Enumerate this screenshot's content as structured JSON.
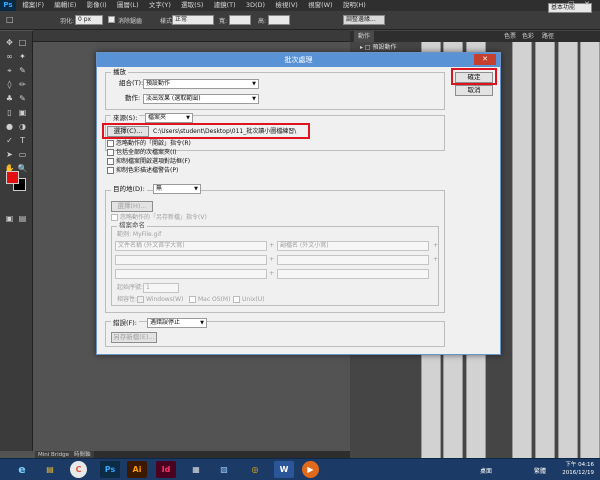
{
  "menubar": {
    "logo": "Ps",
    "items": [
      "檔案(F)",
      "編輯(E)",
      "影像(I)",
      "圖層(L)",
      "文字(Y)",
      "選取(S)",
      "濾鏡(T)",
      "3D(D)",
      "檢視(V)",
      "視窗(W)",
      "說明(H)"
    ]
  },
  "options": {
    "feather_label": "羽化:",
    "feather_value": "0 px",
    "antialias_label": "消除鋸齒",
    "style_label": "樣式:",
    "style_value": "正常",
    "width_label": "寬:",
    "height_label": "高:",
    "refine_button": "調整邊緣...",
    "workspace_value": "基本功能"
  },
  "panel": {
    "tabs": [
      "動作",
      "色票",
      "色彩",
      "路徑"
    ],
    "default_action": "預設動作"
  },
  "bottom_tabs": [
    "Mini Bridge",
    "時間軸"
  ],
  "dialog": {
    "title": "批次處理",
    "ok_button": "確定",
    "reset_button": "取消",
    "play": {
      "legend": "播放",
      "set_label": "組合(T):",
      "set_value": "預設動作",
      "action_label": "動作:",
      "action_value": "淡出效果 (選取範圍)"
    },
    "source": {
      "label": "來源(S):",
      "value": "檔案夾",
      "choose_button": "選擇(C)...",
      "path": "C:\\Users\\student\\Desktop\\011_批次讀小圖檔練習\\",
      "options": [
        "忽略動作的「開啟」指令(R)",
        "包括全部的次檔案夾(I)",
        "抑制檔案開啟選項對話框(F)",
        "抑制色彩描述檔警告(P)"
      ]
    },
    "destination": {
      "label": "目的地(D):",
      "value": "無",
      "choose_button": "選擇(H)...",
      "override_label": "忽略動作的「另存新檔」指令(V)"
    },
    "naming": {
      "legend": "檔案命名",
      "example": "範例: MyFile.gif",
      "field1": "文件名稱 (外文首字大寫)",
      "field2": "副檔名 (外文小寫)",
      "plus": "+",
      "serial_label": "起始序號:",
      "serial_value": "1",
      "compat_label": "相容性:",
      "compat": [
        "Windows(W)",
        "Mac OS(M)",
        "Unix(U)"
      ]
    },
    "errors": {
      "label": "錯誤(F):",
      "value": "遇錯誤停止",
      "save_button": "另存新檔(E)..."
    }
  },
  "taskbar": {
    "apps": [
      "e",
      "C",
      "▤",
      "Ps",
      "Ai",
      "Id",
      "▦",
      "▧",
      "◎",
      "W",
      "▶"
    ],
    "desktop_label": "桌面",
    "ime": "繁體",
    "time": "下午 04:16",
    "date": "2016/12/19"
  },
  "colors": {
    "foreground": "#e41010",
    "background": "#000000",
    "highlight": "#e0141e"
  }
}
